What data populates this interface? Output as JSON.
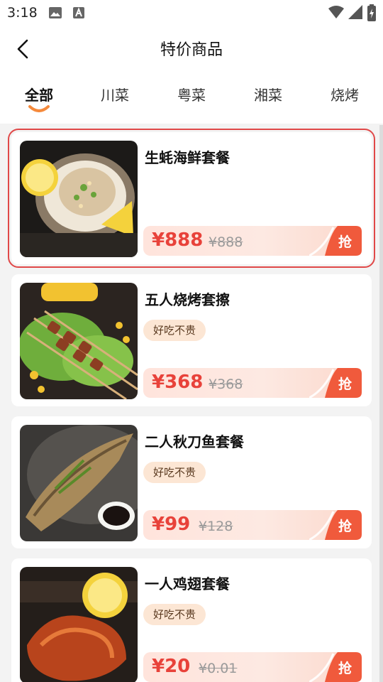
{
  "status_bar": {
    "time": "3:18"
  },
  "header": {
    "title": "特价商品",
    "back_icon": "chevron-left-icon"
  },
  "tabs": [
    {
      "label": "全部",
      "active": true
    },
    {
      "label": "川菜",
      "active": false
    },
    {
      "label": "粤菜",
      "active": false
    },
    {
      "label": "湘菜",
      "active": false
    },
    {
      "label": "烧烤",
      "active": false
    }
  ],
  "colors": {
    "accent": "#e8423a",
    "tab_underline": "#f58a3c",
    "tag_bg": "#fce6d4"
  },
  "products": [
    {
      "name": "生蚝海鲜套餐",
      "tag": "",
      "price": "888",
      "original_price": "888",
      "button": "抢",
      "image": "oyster-image"
    },
    {
      "name": "五人烧烤套擦",
      "tag": "好吃不贵",
      "price": "368",
      "original_price": "368",
      "button": "抢",
      "image": "skewers-image"
    },
    {
      "name": "二人秋刀鱼套餐",
      "tag": "好吃不贵",
      "price": "99",
      "original_price": "128",
      "button": "抢",
      "image": "fish-image"
    },
    {
      "name": "一人鸡翅套餐",
      "tag": "好吃不贵",
      "price": "20",
      "original_price": "0.01",
      "button": "抢",
      "image": "chicken-wing-image"
    }
  ],
  "currency": "¥"
}
